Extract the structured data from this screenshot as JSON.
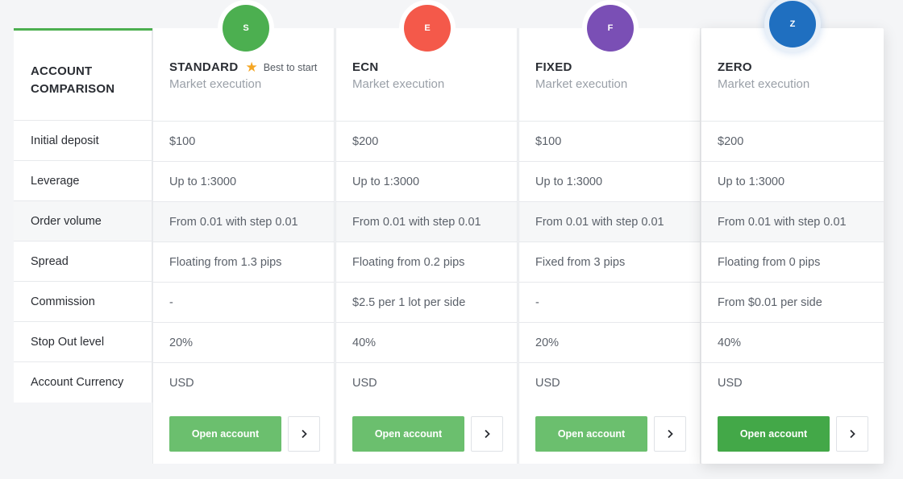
{
  "comparison": {
    "title": "ACCOUNT COMPARISON",
    "row_labels": [
      "Initial deposit",
      "Leverage",
      "Order volume",
      "Spread",
      "Commission",
      "Stop Out level",
      "Account Currency"
    ]
  },
  "accounts": [
    {
      "initial": "S",
      "name": "STANDARD",
      "badge": "Best to start",
      "subtitle": "Market execution",
      "avatar_color": "#4caf50",
      "values": [
        "$100",
        "Up to 1:3000",
        "From 0.01 with step 0.01",
        "Floating from 1.3 pips",
        "-",
        "20%",
        "USD"
      ],
      "button_label": "Open account",
      "button_color": "#6bbf6e"
    },
    {
      "initial": "E",
      "name": "ECN",
      "subtitle": "Market execution",
      "avatar_color": "#f4594a",
      "values": [
        "$200",
        "Up to 1:3000",
        "From 0.01 with step 0.01",
        "Floating from 0.2 pips",
        "$2.5 per 1 lot per side",
        "40%",
        "USD"
      ],
      "button_label": "Open account",
      "button_color": "#6bbf6e"
    },
    {
      "initial": "F",
      "name": "FIXED",
      "subtitle": "Market execution",
      "avatar_color": "#7a4fb5",
      "values": [
        "$100",
        "Up to 1:3000",
        "From 0.01 with step 0.01",
        "Fixed from 3 pips",
        "-",
        "20%",
        "USD"
      ],
      "button_label": "Open account",
      "button_color": "#6bbf6e"
    },
    {
      "initial": "Z",
      "name": "ZERO",
      "subtitle": "Market execution",
      "avatar_color": "#1f6fc0",
      "values": [
        "$200",
        "Up to 1:3000",
        "From 0.01 with step 0.01",
        "Floating from 0 pips",
        "From $0.01 per side",
        "40%",
        "USD"
      ],
      "button_label": "Open account",
      "button_color": "#43a848"
    }
  ],
  "icons": {
    "star": "star-icon",
    "arrow": "chevron-right-icon"
  }
}
